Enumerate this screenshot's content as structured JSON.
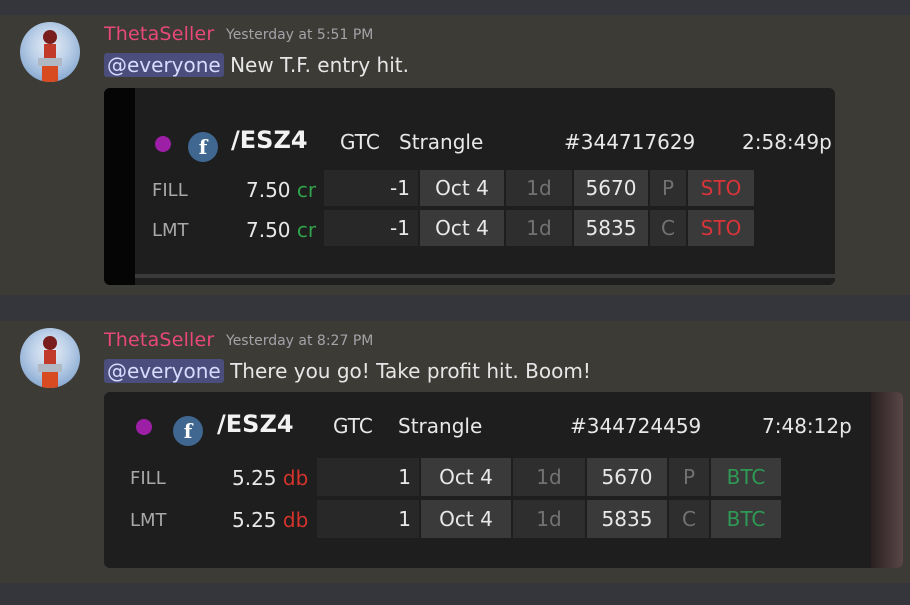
{
  "messages": [
    {
      "author": "ThetaSeller",
      "timestamp": "Yesterday at 5:51 PM",
      "mention": "@everyone",
      "text": "New T.F. entry hit.",
      "embed": {
        "symbol": "/ESZ4",
        "tif": "GTC",
        "strategy": "Strangle",
        "order_id": "#344717629",
        "time": "2:58:49p",
        "legs": [
          {
            "label": "FILL",
            "price": "7.50",
            "side": "cr",
            "qty": "-1",
            "exp": "Oct 4",
            "dte": "1d",
            "strike": "5670",
            "type": "P",
            "action": "STO"
          },
          {
            "label": "LMT",
            "price": "7.50",
            "side": "cr",
            "qty": "-1",
            "exp": "Oct 4",
            "dte": "1d",
            "strike": "5835",
            "type": "C",
            "action": "STO"
          }
        ]
      }
    },
    {
      "author": "ThetaSeller",
      "timestamp": "Yesterday at 8:27 PM",
      "mention": "@everyone",
      "text": "There you go! Take profit hit. Boom!",
      "embed": {
        "symbol": "/ESZ4",
        "tif": "GTC",
        "strategy": "Strangle",
        "order_id": "#344724459",
        "time": "7:48:12p",
        "legs": [
          {
            "label": "FILL",
            "price": "5.25",
            "side": "db",
            "qty": "1",
            "exp": "Oct 4",
            "dte": "1d",
            "strike": "5670",
            "type": "P",
            "action": "BTC"
          },
          {
            "label": "LMT",
            "price": "5.25",
            "side": "db",
            "qty": "1",
            "exp": "Oct 4",
            "dte": "1d",
            "strike": "5835",
            "type": "C",
            "action": "BTC"
          }
        ]
      }
    }
  ],
  "colors": {
    "author": "#e8487a",
    "credit": "#2fa24a",
    "debit": "#d4342c",
    "sto": "#d8343a",
    "btc": "#2f9a55",
    "dot": "#9d1fa5"
  },
  "icons": {
    "avatar": "avatar-icon",
    "status": "purple-dot-icon",
    "facebook": "f-circle-icon"
  }
}
